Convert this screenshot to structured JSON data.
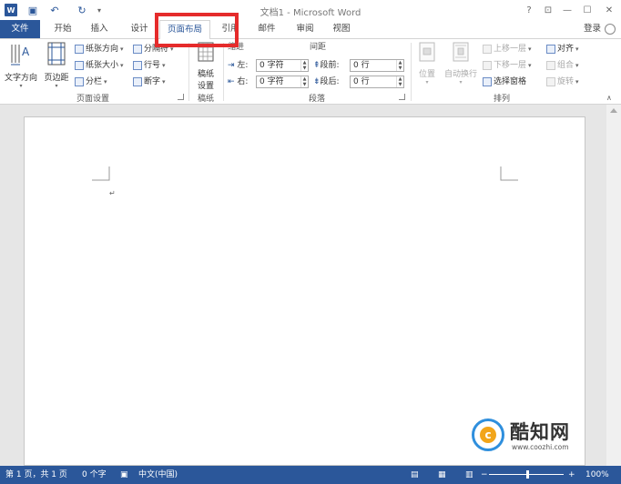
{
  "window": {
    "title": "文档1 - Microsoft Word",
    "logo_letter": "W",
    "quick_access": [
      {
        "name": "save-icon",
        "glyph": "▣"
      },
      {
        "name": "undo-icon",
        "glyph": "↶"
      },
      {
        "name": "redo-icon",
        "glyph": "↻"
      },
      {
        "name": "customize-icon",
        "glyph": "▾"
      }
    ],
    "controls": [
      {
        "name": "help-icon",
        "glyph": "?"
      },
      {
        "name": "ribbon-options-icon",
        "glyph": "⊡"
      },
      {
        "name": "minimize-icon",
        "glyph": "—"
      },
      {
        "name": "restore-icon",
        "glyph": "☐"
      },
      {
        "name": "close-icon",
        "glyph": "✕"
      }
    ]
  },
  "tabs": {
    "file": "文件",
    "items": [
      "开始",
      "插入",
      "设计",
      "页面布局",
      "引用",
      "邮件",
      "审阅",
      "视图"
    ],
    "active": "页面布局",
    "login": "登录"
  },
  "ribbon": {
    "page_setup": {
      "label": "页面设置",
      "text_direction": "文字方向",
      "margins": "页边距",
      "orientation": "纸张方向",
      "size": "纸张大小",
      "columns": "分栏",
      "breaks": "分隔符",
      "line_numbers": "行号",
      "hyphenation": "断字"
    },
    "draft": {
      "label": "稿纸",
      "button_line1": "稿纸",
      "button_line2": "设置"
    },
    "paragraph": {
      "label": "段落",
      "indent_header": "缩进",
      "spacing_header": "间距",
      "left_label": "左:",
      "left_value": "0 字符",
      "right_label": "右:",
      "right_value": "0 字符",
      "before_label": "段前:",
      "before_value": "0 行",
      "after_label": "段后:",
      "after_value": "0 行"
    },
    "arrange": {
      "label": "排列",
      "position": "位置",
      "wrap_text": "自动换行",
      "bring_forward": "上移一层",
      "send_backward": "下移一层",
      "selection_pane": "选择窗格",
      "align": "对齐",
      "group": "组合",
      "rotate": "旋转"
    }
  },
  "document": {
    "paragraph_mark": "↵"
  },
  "watermark": {
    "brand": "酷知网",
    "url": "www.coozhi.com",
    "logo_letter": "c"
  },
  "status": {
    "page": "第 1 页，共 1 页",
    "words": "0 个字",
    "language": "中文(中国)",
    "zoom": "100%",
    "zoom_out": "−",
    "zoom_in": "+"
  },
  "colors": {
    "accent": "#2b579a",
    "highlight": "#e52b2b"
  }
}
